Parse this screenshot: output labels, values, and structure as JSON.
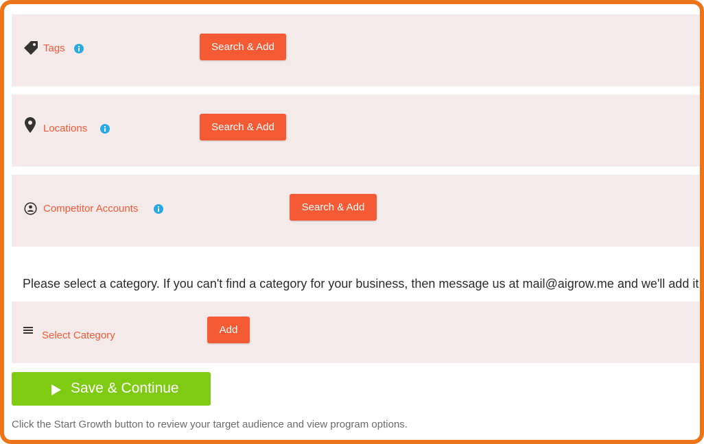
{
  "colors": {
    "frame_border": "#EE7418",
    "panel_bg": "#F3EAE9",
    "label": "#EF5B36",
    "button": "#F45A33",
    "info": "#29ABE2",
    "save_button": "#7FCB13"
  },
  "sections": [
    {
      "label": "Tags",
      "icon": "tag-icon",
      "button_label": "Search & Add"
    },
    {
      "label": "Locations",
      "icon": "map-pin-icon",
      "button_label": "Search & Add"
    },
    {
      "label": "Competitor Accounts",
      "icon": "user-circle-icon",
      "button_label": "Search & Add"
    }
  ],
  "category": {
    "message": "Please select a category. If you can't find a category for your business, then message us at mail@aigrow.me and we'll add it in",
    "label": "Select Category",
    "icon": "list-icon",
    "button_label": "Add"
  },
  "save_button": {
    "label": "Save & Continue",
    "icon": "play-icon"
  },
  "footer_note": "Click the Start Growth button to review your target audience and view program options."
}
